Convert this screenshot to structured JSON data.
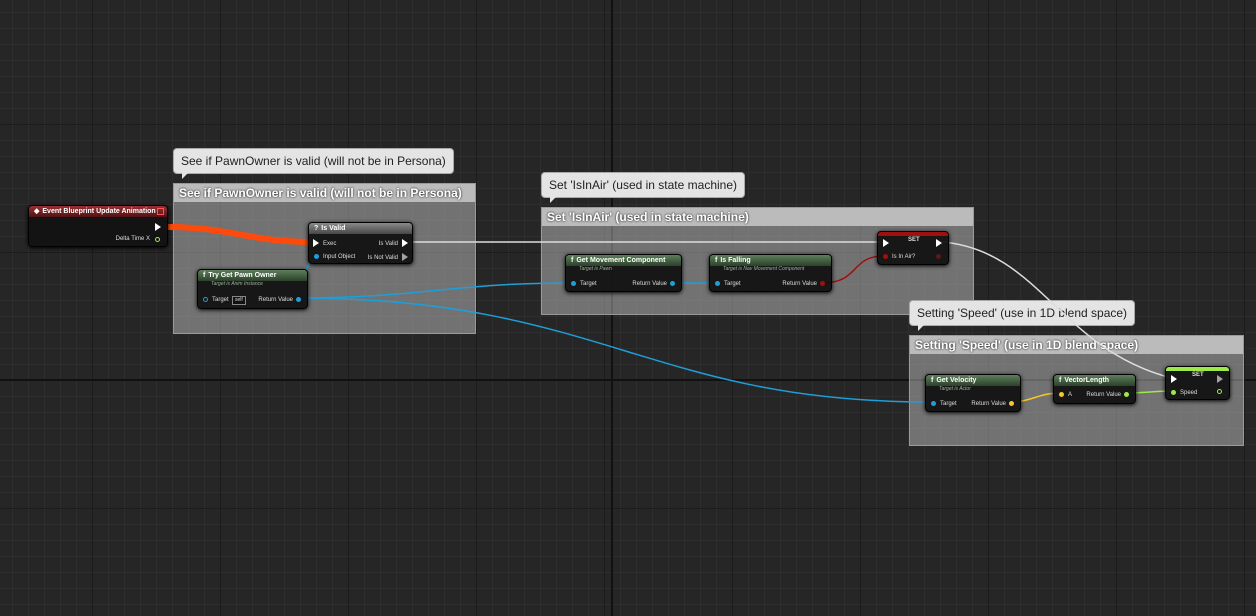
{
  "comments": {
    "pawn_check": {
      "title": "See if PawnOwner is valid (will not be in Persona)",
      "bubble": "See if PawnOwner is valid (will not be in Persona)"
    },
    "in_air": {
      "title": "Set 'IsInAir' (used in state machine)",
      "bubble": "Set 'IsInAir' (used in state machine)"
    },
    "speed": {
      "title": "Setting 'Speed' (use in 1D blend space)",
      "bubble": "Setting 'Speed' (use in 1D blend space)"
    }
  },
  "nodes": {
    "event": {
      "title": "Event Blueprint Update Animation",
      "delta": "Delta Time X"
    },
    "is_valid": {
      "icon": "?",
      "title": "Is Valid",
      "exec": "Exec",
      "input": "Input Object",
      "valid": "Is Valid",
      "not_valid": "Is Not Valid"
    },
    "try_get_pawn": {
      "icon": "f",
      "title": "Try Get Pawn Owner",
      "sub": "Target is Anim Instance",
      "target": "Target",
      "self": "self",
      "ret": "Return Value"
    },
    "get_move": {
      "icon": "f",
      "title": "Get Movement Component",
      "sub": "Target is Pawn",
      "target": "Target",
      "ret": "Return Value"
    },
    "is_falling": {
      "icon": "f",
      "title": "Is Falling",
      "sub": "Target is Nav Movement Component",
      "target": "Target",
      "ret": "Return Value"
    },
    "set_air": {
      "title": "SET",
      "var": "Is In Air?"
    },
    "get_velocity": {
      "icon": "f",
      "title": "Get Velocity",
      "sub": "Target is Actor",
      "target": "Target",
      "ret": "Return Value"
    },
    "vector_length": {
      "icon": "f",
      "title": "VectorLength",
      "a": "A",
      "ret": "Return Value"
    },
    "set_speed": {
      "title": "SET",
      "var": "Speed"
    }
  },
  "colors": {
    "exec_wire": "#ffffff",
    "object_wire": "#1f9ed8",
    "bool_wire": "#a01010",
    "vector_wire": "#f7c72a",
    "float_wire": "#9ee94a",
    "active_exec": "#ff4a0c"
  }
}
